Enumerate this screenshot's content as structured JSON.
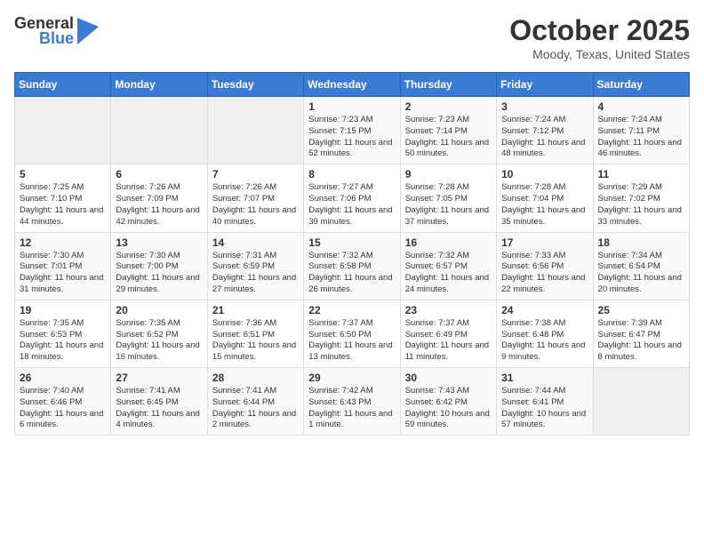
{
  "header": {
    "logo_general": "General",
    "logo_blue": "Blue",
    "month_title": "October 2025",
    "location": "Moody, Texas, United States"
  },
  "weekdays": [
    "Sunday",
    "Monday",
    "Tuesday",
    "Wednesday",
    "Thursday",
    "Friday",
    "Saturday"
  ],
  "weeks": [
    [
      {
        "day": "",
        "info": ""
      },
      {
        "day": "",
        "info": ""
      },
      {
        "day": "",
        "info": ""
      },
      {
        "day": "1",
        "info": "Sunrise: 7:23 AM\nSunset: 7:15 PM\nDaylight: 11 hours and 52 minutes."
      },
      {
        "day": "2",
        "info": "Sunrise: 7:23 AM\nSunset: 7:14 PM\nDaylight: 11 hours and 50 minutes."
      },
      {
        "day": "3",
        "info": "Sunrise: 7:24 AM\nSunset: 7:12 PM\nDaylight: 11 hours and 48 minutes."
      },
      {
        "day": "4",
        "info": "Sunrise: 7:24 AM\nSunset: 7:11 PM\nDaylight: 11 hours and 46 minutes."
      }
    ],
    [
      {
        "day": "5",
        "info": "Sunrise: 7:25 AM\nSunset: 7:10 PM\nDaylight: 11 hours and 44 minutes."
      },
      {
        "day": "6",
        "info": "Sunrise: 7:26 AM\nSunset: 7:09 PM\nDaylight: 11 hours and 42 minutes."
      },
      {
        "day": "7",
        "info": "Sunrise: 7:26 AM\nSunset: 7:07 PM\nDaylight: 11 hours and 40 minutes."
      },
      {
        "day": "8",
        "info": "Sunrise: 7:27 AM\nSunset: 7:06 PM\nDaylight: 11 hours and 39 minutes."
      },
      {
        "day": "9",
        "info": "Sunrise: 7:28 AM\nSunset: 7:05 PM\nDaylight: 11 hours and 37 minutes."
      },
      {
        "day": "10",
        "info": "Sunrise: 7:28 AM\nSunset: 7:04 PM\nDaylight: 11 hours and 35 minutes."
      },
      {
        "day": "11",
        "info": "Sunrise: 7:29 AM\nSunset: 7:02 PM\nDaylight: 11 hours and 33 minutes."
      }
    ],
    [
      {
        "day": "12",
        "info": "Sunrise: 7:30 AM\nSunset: 7:01 PM\nDaylight: 11 hours and 31 minutes."
      },
      {
        "day": "13",
        "info": "Sunrise: 7:30 AM\nSunset: 7:00 PM\nDaylight: 11 hours and 29 minutes."
      },
      {
        "day": "14",
        "info": "Sunrise: 7:31 AM\nSunset: 6:59 PM\nDaylight: 11 hours and 27 minutes."
      },
      {
        "day": "15",
        "info": "Sunrise: 7:32 AM\nSunset: 6:58 PM\nDaylight: 11 hours and 26 minutes."
      },
      {
        "day": "16",
        "info": "Sunrise: 7:32 AM\nSunset: 6:57 PM\nDaylight: 11 hours and 24 minutes."
      },
      {
        "day": "17",
        "info": "Sunrise: 7:33 AM\nSunset: 6:56 PM\nDaylight: 11 hours and 22 minutes."
      },
      {
        "day": "18",
        "info": "Sunrise: 7:34 AM\nSunset: 6:54 PM\nDaylight: 11 hours and 20 minutes."
      }
    ],
    [
      {
        "day": "19",
        "info": "Sunrise: 7:35 AM\nSunset: 6:53 PM\nDaylight: 11 hours and 18 minutes."
      },
      {
        "day": "20",
        "info": "Sunrise: 7:35 AM\nSunset: 6:52 PM\nDaylight: 11 hours and 16 minutes."
      },
      {
        "day": "21",
        "info": "Sunrise: 7:36 AM\nSunset: 6:51 PM\nDaylight: 11 hours and 15 minutes."
      },
      {
        "day": "22",
        "info": "Sunrise: 7:37 AM\nSunset: 6:50 PM\nDaylight: 11 hours and 13 minutes."
      },
      {
        "day": "23",
        "info": "Sunrise: 7:37 AM\nSunset: 6:49 PM\nDaylight: 11 hours and 11 minutes."
      },
      {
        "day": "24",
        "info": "Sunrise: 7:38 AM\nSunset: 6:48 PM\nDaylight: 11 hours and 9 minutes."
      },
      {
        "day": "25",
        "info": "Sunrise: 7:39 AM\nSunset: 6:47 PM\nDaylight: 11 hours and 8 minutes."
      }
    ],
    [
      {
        "day": "26",
        "info": "Sunrise: 7:40 AM\nSunset: 6:46 PM\nDaylight: 11 hours and 6 minutes."
      },
      {
        "day": "27",
        "info": "Sunrise: 7:41 AM\nSunset: 6:45 PM\nDaylight: 11 hours and 4 minutes."
      },
      {
        "day": "28",
        "info": "Sunrise: 7:41 AM\nSunset: 6:44 PM\nDaylight: 11 hours and 2 minutes."
      },
      {
        "day": "29",
        "info": "Sunrise: 7:42 AM\nSunset: 6:43 PM\nDaylight: 11 hours and 1 minute."
      },
      {
        "day": "30",
        "info": "Sunrise: 7:43 AM\nSunset: 6:42 PM\nDaylight: 10 hours and 59 minutes."
      },
      {
        "day": "31",
        "info": "Sunrise: 7:44 AM\nSunset: 6:41 PM\nDaylight: 10 hours and 57 minutes."
      },
      {
        "day": "",
        "info": ""
      }
    ]
  ]
}
